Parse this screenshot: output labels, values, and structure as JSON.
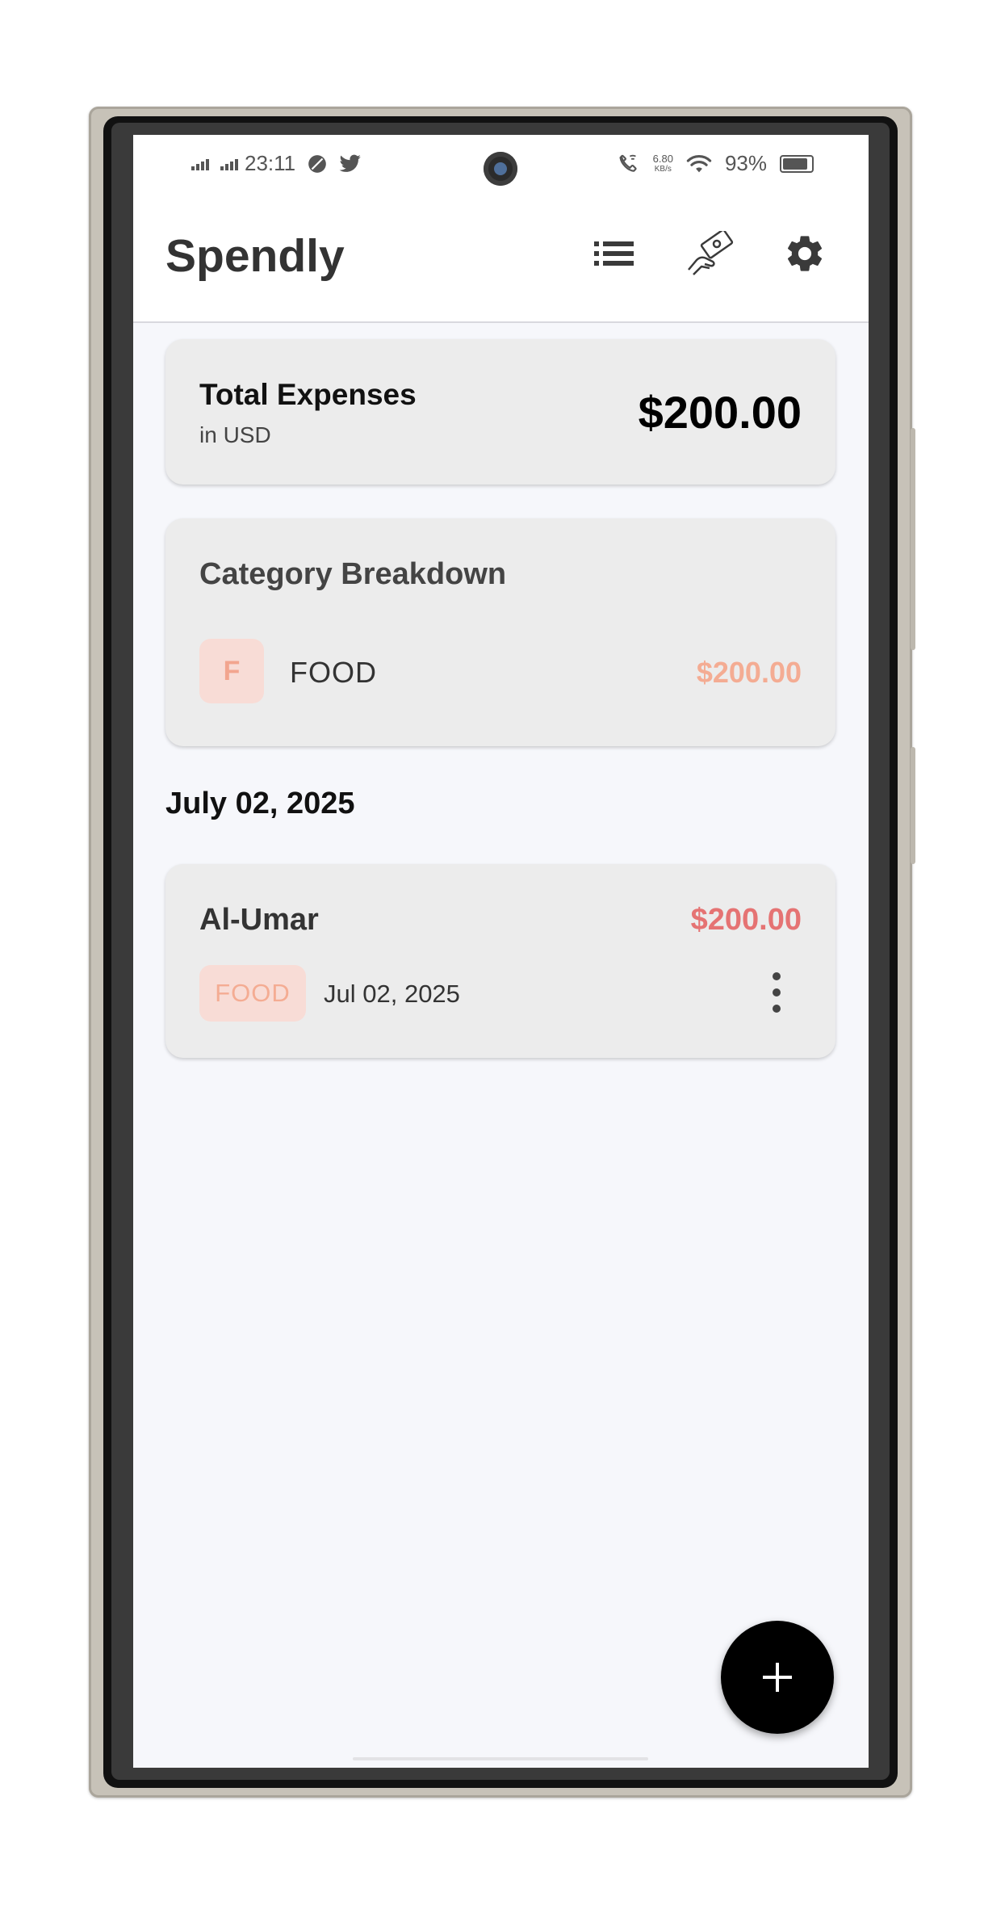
{
  "status_bar": {
    "time": "23:11",
    "net_speed_value": "6.80",
    "net_speed_unit": "KB/s",
    "battery": "93%",
    "icons": [
      "signal-icon",
      "signal-icon",
      "leaf-icon",
      "twitter-icon",
      "wifi-call-icon",
      "wifi-icon",
      "battery-icon"
    ]
  },
  "app_bar": {
    "title": "Spendly",
    "icons": [
      "list-icon",
      "hand-money-icon",
      "settings-icon"
    ]
  },
  "summary": {
    "title": "Total Expenses",
    "subtitle": "in USD",
    "amount": "$200.00"
  },
  "breakdown": {
    "title": "Category Breakdown",
    "categories": [
      {
        "initial": "F",
        "name": "FOOD",
        "amount": "$200.00",
        "color": "#f4ac93"
      }
    ]
  },
  "groups": [
    {
      "date": "July 02, 2025",
      "expenses": [
        {
          "merchant": "Al-Umar",
          "amount": "$200.00",
          "category": "FOOD",
          "date": "Jul 02, 2025"
        }
      ]
    }
  ],
  "fab": {
    "icon": "plus-icon"
  },
  "colors": {
    "accent": "#000000",
    "amount_red": "#e57373",
    "category_food": "#f4ac93",
    "background": "#f6f7fb"
  }
}
